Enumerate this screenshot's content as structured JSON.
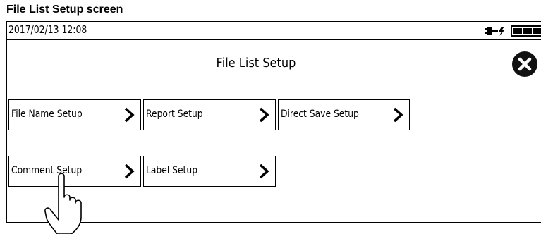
{
  "caption": "File List Setup screen",
  "statusbar": {
    "datetime": "2017/02/13 12:08",
    "power_icon": "ac-power-icon",
    "battery_icon": "battery-icon"
  },
  "title": "File List Setup",
  "close_icon": "close-icon",
  "buttons": [
    {
      "label": "File Name Setup",
      "icon": "chevron-right-icon"
    },
    {
      "label": "Report Setup",
      "icon": "chevron-right-icon"
    },
    {
      "label": "Direct Save Setup",
      "icon": "chevron-right-icon"
    },
    {
      "label": "Comment Setup",
      "icon": "chevron-right-icon"
    },
    {
      "label": "Label Setup",
      "icon": "chevron-right-icon"
    }
  ],
  "pointer_icon": "hand-pointer-icon"
}
